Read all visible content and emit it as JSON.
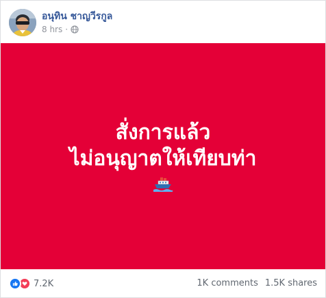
{
  "post": {
    "author": "อนุทิน ชาญวีรกูล",
    "time": "8 hrs",
    "separator": "·",
    "privacy_icon": "globe-icon",
    "banner": {
      "background": "#e40037",
      "line1": "สั่งการแล้ว",
      "line2": "ไม่อนุญาตให้เทียบท่า",
      "emoji_icon": "ship-icon"
    },
    "reactions": {
      "icons": [
        "like-icon",
        "love-icon"
      ],
      "count": "7.2K"
    },
    "comments": "1K comments",
    "shares": "1.5K shares"
  },
  "colors": {
    "author_link": "#365899",
    "meta_text": "#90949c",
    "like_blue": "#1877f2",
    "love_red": "#f33e58"
  }
}
